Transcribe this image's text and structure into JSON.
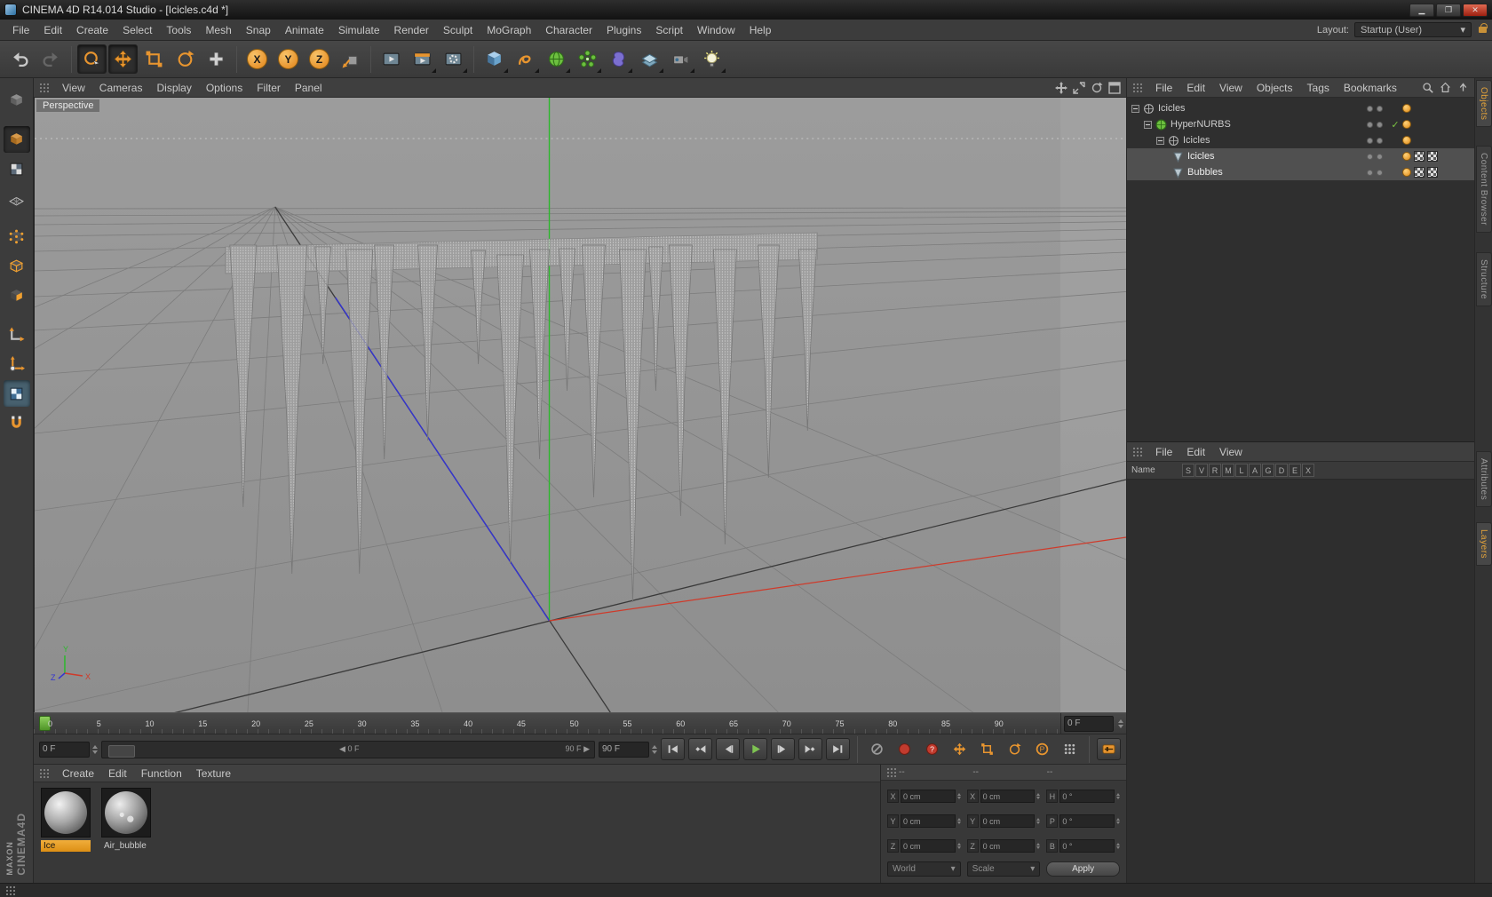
{
  "window": {
    "title": "CINEMA 4D R14.014 Studio - [Icicles.c4d *]",
    "layout_label": "Layout:",
    "layout_value": "Startup (User)"
  },
  "menubar": [
    "File",
    "Edit",
    "Create",
    "Select",
    "Tools",
    "Mesh",
    "Snap",
    "Animate",
    "Simulate",
    "Render",
    "Sculpt",
    "MoGraph",
    "Character",
    "Plugins",
    "Script",
    "Window",
    "Help"
  ],
  "toolbar": {
    "axis_labels": [
      "X",
      "Y",
      "Z"
    ]
  },
  "viewport": {
    "menus": [
      "View",
      "Cameras",
      "Display",
      "Options",
      "Filter",
      "Panel"
    ],
    "camera_label": "Perspective",
    "gizmo": {
      "x": "X",
      "y": "Y",
      "z": "Z"
    }
  },
  "object_manager": {
    "menus": [
      "File",
      "Edit",
      "View",
      "Objects",
      "Tags",
      "Bookmarks"
    ],
    "rows": [
      {
        "label": "Icicles"
      },
      {
        "label": "HyperNURBS"
      },
      {
        "label": "Icicles"
      },
      {
        "label": "Icicles"
      },
      {
        "label": "Bubbles"
      }
    ]
  },
  "layer_manager": {
    "menus": [
      "File",
      "Edit",
      "View"
    ],
    "name_header": "Name",
    "columns": [
      "S",
      "V",
      "R",
      "M",
      "L",
      "A",
      "G",
      "D",
      "E",
      "X"
    ]
  },
  "side_tabs": {
    "top": [
      "Objects",
      "Content Browser",
      "Structure"
    ],
    "bottom": [
      "Attributes",
      "Layers"
    ]
  },
  "timeline": {
    "ticks": [
      "0",
      "5",
      "10",
      "15",
      "20",
      "25",
      "30",
      "35",
      "40",
      "45",
      "50",
      "55",
      "60",
      "65",
      "70",
      "75",
      "80",
      "85",
      "90"
    ],
    "frame_field": "0 F",
    "start_field": "0 F",
    "slider_current": "0 F",
    "slider_end": "90 F",
    "end_field": "90 F"
  },
  "glyphs": {
    "left": "◀",
    "right": "▶",
    "down": "▾",
    "check": "✓",
    "question": "?",
    "p": "P"
  },
  "materials": {
    "menus": [
      "Create",
      "Edit",
      "Function",
      "Texture"
    ],
    "items": [
      {
        "name": "Ice"
      },
      {
        "name": "Air_bubble"
      }
    ]
  },
  "coordinates": {
    "headers": [
      "--",
      "--",
      "--"
    ],
    "rows": [
      {
        "pl": "X",
        "pv": "0 cm",
        "sl": "X",
        "sv": "0 cm",
        "rl": "H",
        "rv": "0 °"
      },
      {
        "pl": "Y",
        "pv": "0 cm",
        "sl": "Y",
        "sv": "0 cm",
        "rl": "P",
        "rv": "0 °"
      },
      {
        "pl": "Z",
        "pv": "0 cm",
        "sl": "Z",
        "sv": "0 cm",
        "rl": "B",
        "rv": "0 °"
      }
    ],
    "mode_world": "World",
    "mode_scale": "Scale",
    "apply": "Apply"
  },
  "branding": {
    "line1": "MAXON",
    "line2": "CINEMA4D"
  },
  "viewport_scene": {
    "slab": [
      [
        215,
        168
      ],
      [
        882,
        152
      ],
      [
        882,
        182
      ],
      [
        215,
        198
      ]
    ],
    "icicles": [
      [
        235,
        166,
        461,
        15
      ],
      [
        290,
        166,
        536,
        17
      ],
      [
        325,
        168,
        300,
        9
      ],
      [
        366,
        171,
        536,
        15
      ],
      [
        394,
        166,
        407,
        11
      ],
      [
        443,
        166,
        386,
        11
      ],
      [
        500,
        172,
        300,
        8
      ],
      [
        536,
        177,
        525,
        15
      ],
      [
        569,
        171,
        407,
        11
      ],
      [
        600,
        170,
        330,
        9
      ],
      [
        630,
        166,
        450,
        13
      ],
      [
        674,
        171,
        568,
        15
      ],
      [
        700,
        168,
        330,
        8
      ],
      [
        728,
        166,
        471,
        13
      ],
      [
        778,
        171,
        503,
        13
      ],
      [
        827,
        166,
        428,
        12
      ],
      [
        871,
        171,
        375,
        10
      ]
    ]
  }
}
